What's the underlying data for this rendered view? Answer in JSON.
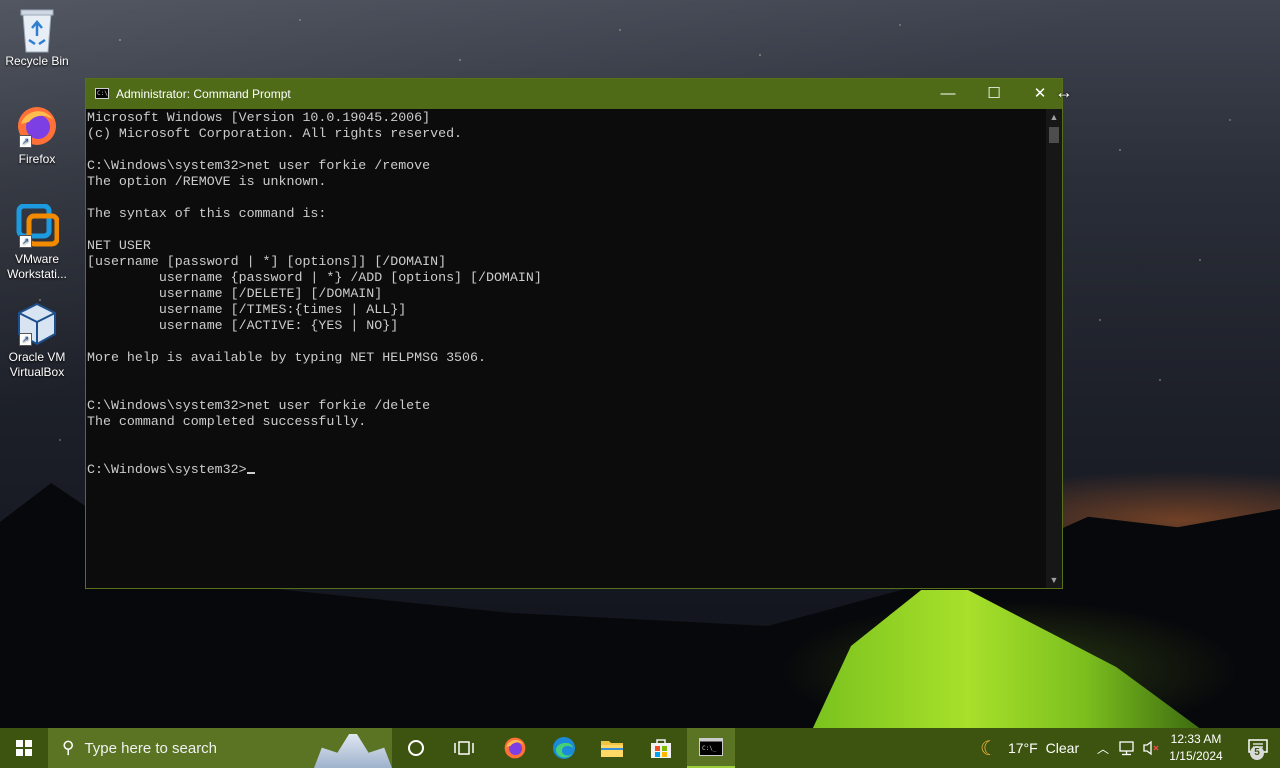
{
  "desktop": {
    "icons": [
      {
        "label": "Recycle Bin"
      },
      {
        "label": "Firefox"
      },
      {
        "label": "VMware Workstati..."
      },
      {
        "label": "Oracle VM VirtualBox"
      }
    ]
  },
  "cmd_window": {
    "title": "Administrator: Command Prompt",
    "minimize_symbol": "—",
    "maximize_symbol": "☐",
    "close_symbol": "✕",
    "lines": [
      "Microsoft Windows [Version 10.0.19045.2006]",
      "(c) Microsoft Corporation. All rights reserved.",
      "",
      "C:\\Windows\\system32>net user forkie /remove",
      "The option /REMOVE is unknown.",
      "",
      "The syntax of this command is:",
      "",
      "NET USER",
      "[username [password | *] [options]] [/DOMAIN]",
      "         username {password | *} /ADD [options] [/DOMAIN]",
      "         username [/DELETE] [/DOMAIN]",
      "         username [/TIMES:{times | ALL}]",
      "         username [/ACTIVE: {YES | NO}]",
      "",
      "More help is available by typing NET HELPMSG 3506.",
      "",
      "",
      "C:\\Windows\\system32>net user forkie /delete",
      "The command completed successfully.",
      "",
      ""
    ],
    "prompt": "C:\\Windows\\system32>"
  },
  "taskbar": {
    "search_placeholder": "Type here to search",
    "weather_temp": "17°F",
    "weather_desc": "Clear",
    "time": "12:33 AM",
    "date": "1/15/2024",
    "notification_count": "5"
  },
  "colors": {
    "accent": "#4f6b18",
    "taskbar": "#3c5410",
    "console_bg": "#0c0c0c",
    "console_fg": "#cccccc"
  }
}
